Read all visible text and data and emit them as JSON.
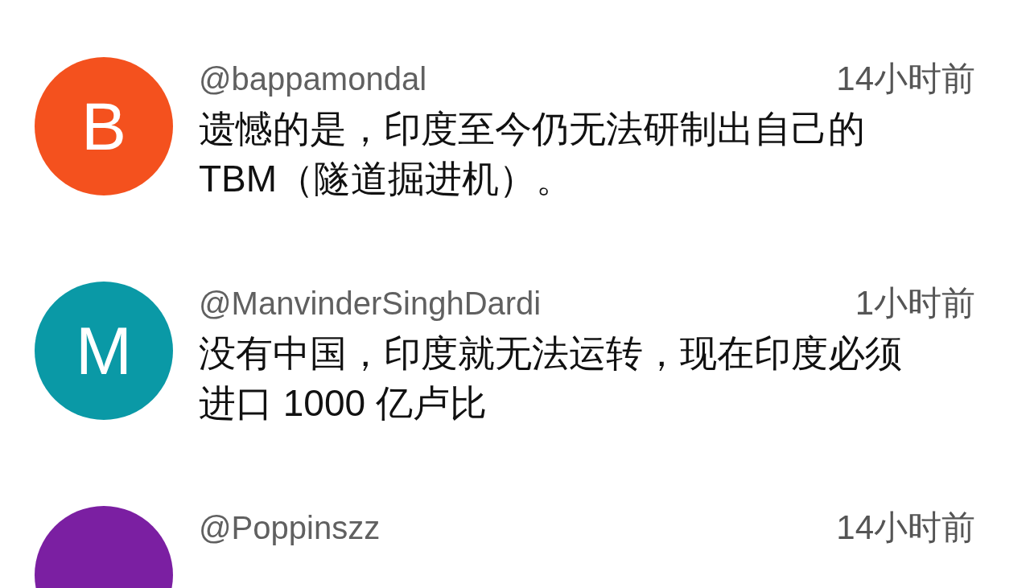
{
  "comments": [
    {
      "avatar": {
        "letter": "B",
        "color": "#f4511e"
      },
      "author": "@bappamondal",
      "time": "14小时前",
      "text": "遗憾的是，印度至今仍无法研制出自己的TBM（隧道掘进机）。"
    },
    {
      "avatar": {
        "letter": "M",
        "color": "#0a99a6"
      },
      "author": "@ManvinderSinghDardi",
      "time": "1小时前",
      "text": "没有中国，印度就无法运转，现在印度必须进口 1000 亿卢比"
    },
    {
      "avatar": {
        "color": "#7b1fa2"
      },
      "author": "@Poppinszz",
      "time": "14小时前"
    }
  ]
}
